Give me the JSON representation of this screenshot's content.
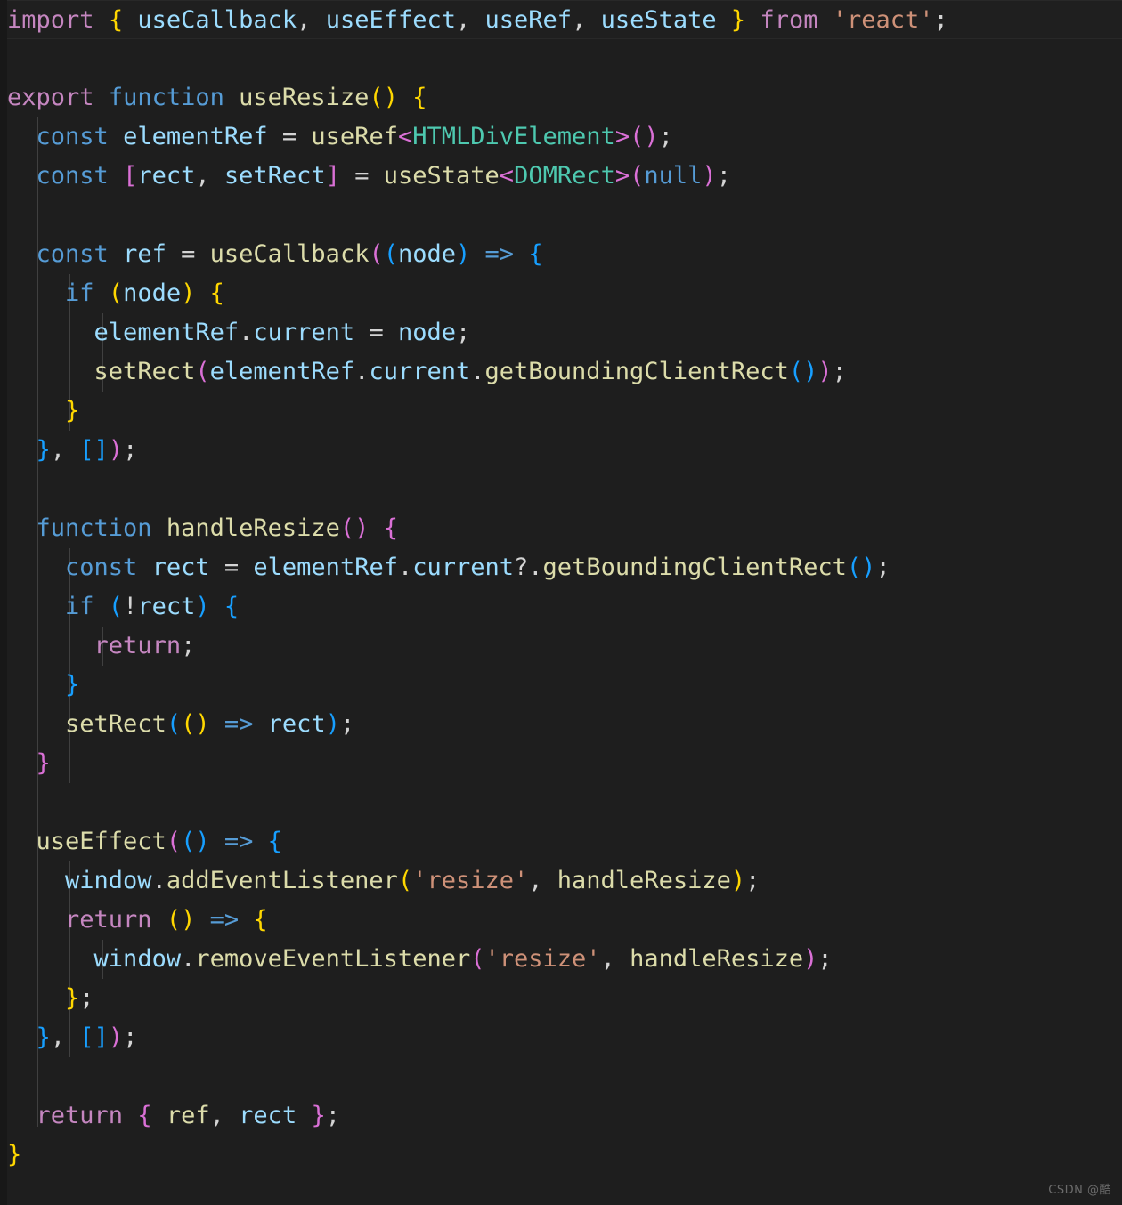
{
  "editor": {
    "language": "typescript",
    "theme": "dark-plus",
    "background_color": "#1e1e1e",
    "current_line": 1,
    "colors": {
      "keyword_control": "#c586c0",
      "keyword": "#569cd6",
      "function": "#dcdcaa",
      "variable": "#9cdcfe",
      "type": "#4ec9b0",
      "string": "#ce9178",
      "bracket_1": "#ffd700",
      "bracket_2": "#da70d6",
      "bracket_3": "#179fff",
      "default_text": "#d4d4d4",
      "indent_guide": "#404040"
    }
  },
  "code": {
    "lines": [
      "import { useCallback, useEffect, useRef, useState } from 'react';",
      "",
      "export function useResize() {",
      "  const elementRef = useRef<HTMLDivElement>();",
      "  const [rect, setRect] = useState<DOMRect>(null);",
      "",
      "  const ref = useCallback((node) => {",
      "    if (node) {",
      "      elementRef.current = node;",
      "      setRect(elementRef.current.getBoundingClientRect());",
      "    }",
      "  }, []);",
      "",
      "  function handleResize() {",
      "    const rect = elementRef.current?.getBoundingClientRect();",
      "    if (!rect) {",
      "      return;",
      "    }",
      "    setRect(() => rect);",
      "  }",
      "",
      "  useEffect(() => {",
      "    window.addEventListener('resize', handleResize);",
      "    return () => {",
      "      window.removeEventListener('resize', handleResize);",
      "    };",
      "  }, []);",
      "",
      "  return { ref, rect };",
      "}"
    ]
  },
  "watermark": {
    "text": "CSDN @酷"
  }
}
